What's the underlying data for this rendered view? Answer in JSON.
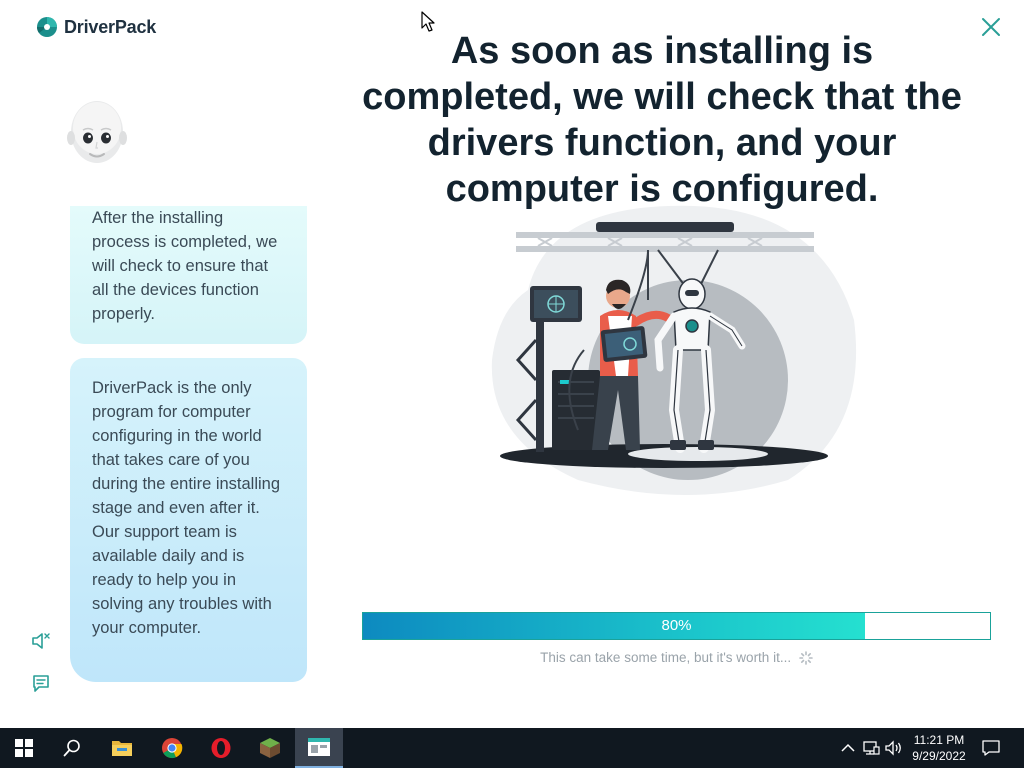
{
  "app": {
    "logo_text": "DriverPack",
    "headline": "As soon as installing is completed, we will check that the drivers function, and your computer is configured.",
    "bubbles": [
      "After the installing process is completed, we will check to ensure that all the devices function properly.",
      "DriverPack is the only program for computer configuring in the world that takes care of you during the entire installing stage and even after it. Our support team is available daily and is ready to help you in solving any troubles with your computer."
    ],
    "progress": {
      "value": 0.8,
      "label": "80%"
    },
    "hint": "This can take some time, but it's worth it...",
    "icons": {
      "close": "close-icon",
      "sound": "speaker-muted-icon",
      "chat": "chat-icon"
    },
    "colors": {
      "accent": "#1cc9cc",
      "progress_start": "#0d8ac0",
      "heading": "#13232f"
    }
  },
  "taskbar": {
    "time": "11:21 PM",
    "date": "9/29/2022",
    "apps": [
      "start-icon",
      "search-icon",
      "file-explorer-icon",
      "chrome-icon",
      "opera-icon",
      "minecraft-icon",
      "driverpack-icon"
    ]
  }
}
